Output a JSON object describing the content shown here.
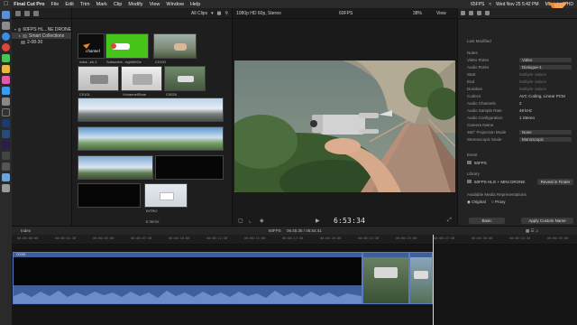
{
  "menubar": {
    "app_name": "Final Cut Pro",
    "menus": [
      "File",
      "Edit",
      "Trim",
      "Mark",
      "Clip",
      "Modify",
      "View",
      "Window",
      "Help"
    ],
    "status_fps": "65FPS",
    "clock": "Wed Nov 25 5:42 PM",
    "volume": "Macintosh HD"
  },
  "libraries": {
    "items": [
      {
        "label": "60FPS HL...NE DRONE",
        "indent": 0,
        "tri": "▾",
        "selected": false
      },
      {
        "label": "Smart Collections",
        "indent": 1,
        "tri": "▸",
        "selected": true
      },
      {
        "label": "2-08-30",
        "indent": 1,
        "tri": "",
        "selected": false
      }
    ]
  },
  "browser": {
    "filter": "All Clips",
    "count": "6 Items",
    "clips": [
      {
        "label": "vcha...ek-1",
        "name": "clip-channel-logo"
      },
      {
        "label": "Subscribe...rightWiGe",
        "name": "clip-subscribe-green"
      },
      {
        "label": "C0190",
        "name": "clip-c0190"
      },
      {
        "label": "C0101",
        "name": "clip-c0101"
      },
      {
        "label": "VchannelStore",
        "name": "clip-vchannelstore"
      },
      {
        "label": "C0026",
        "name": "clip-c0026"
      },
      {
        "label": "INTRO",
        "name": "clip-intro"
      }
    ]
  },
  "viewer": {
    "format": "1080p HD 60p, Stereo",
    "title": "60FPS",
    "zoom": "38%",
    "view": "View",
    "timecode": "6:53:34"
  },
  "inspector": {
    "subtitle": "Last Modified",
    "rows": [
      {
        "key": "Notes",
        "value": "",
        "style": ""
      },
      {
        "key": "Video Roles",
        "value": "Video",
        "style": "popup"
      },
      {
        "key": "Audio Roles",
        "value": "Dialogue-1",
        "style": "popup"
      },
      {
        "key": "Start",
        "value": "Multiple Values",
        "style": "dim"
      },
      {
        "key": "End",
        "value": "Multiple Values",
        "style": "dim"
      },
      {
        "key": "Duration",
        "value": "Multiple Values",
        "style": "dim"
      },
      {
        "key": "Codecs",
        "value": "AVC Coding, Linear PCM",
        "style": ""
      },
      {
        "key": "Audio Channels",
        "value": "2",
        "style": ""
      },
      {
        "key": "Audio Sample Rate",
        "value": "48 kHz",
        "style": ""
      },
      {
        "key": "Audio Configuration",
        "value": "1 Stereo",
        "style": ""
      },
      {
        "key": "Camera Name",
        "value": "",
        "style": ""
      },
      {
        "key": "360° Projection Mode",
        "value": "None",
        "style": "popup"
      },
      {
        "key": "Stereoscopic Mode",
        "value": "Monoscopic",
        "style": "popup"
      }
    ],
    "event_label": "Event",
    "event_value": "60FPS",
    "location_label": "Library",
    "location_value": "60FPS HLG + MINI DRONE",
    "reveal_button": "Reveal in Finder",
    "representation_label": "Available Media Representations",
    "original": "Original",
    "proxy": "Proxy",
    "basic_popup": "Basic",
    "apply_button": "Apply Custom Name"
  },
  "timeline": {
    "index_label": "Index",
    "project": "60FPS",
    "position": "06:45:35 / 06:54:41",
    "ruler_ticks": [
      "00:00:00:00",
      "00:00:02:30",
      "00:00:05:00",
      "00:00:07:30",
      "00:00:10:00",
      "00:00:12:30",
      "00:00:15:00",
      "00:00:17:30",
      "00:00:20:00",
      "00:00:22:30",
      "00:00:25:00",
      "00:00:27:30",
      "00:00:30:00",
      "00:00:32:30",
      "00:00:35:00"
    ],
    "clip_label": "C0026"
  },
  "watermark": {
    "brand": "channel"
  },
  "colors": {
    "accent_orange": "#f0871f",
    "clip_blue": "#3f5f9b",
    "waveform_blue": "#4d6fb0",
    "subscribe_green": "#47c41a"
  }
}
